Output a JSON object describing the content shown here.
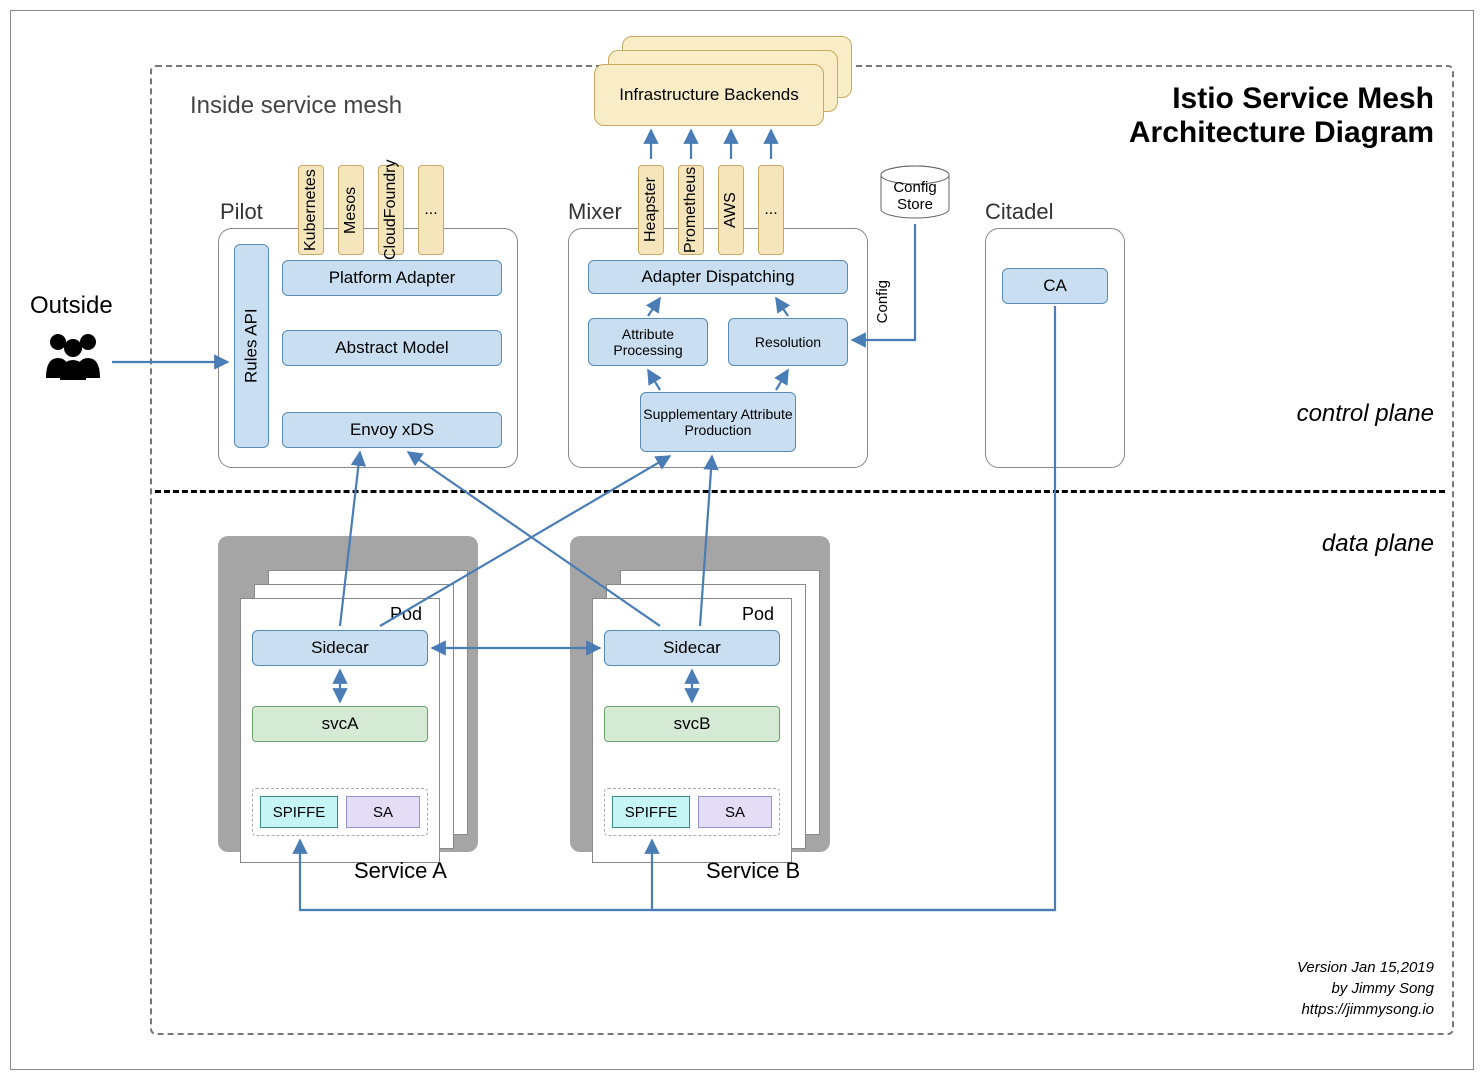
{
  "title": {
    "line1": "Istio Service Mesh",
    "line2": "Architecture Diagram"
  },
  "mesh_label": "Inside service mesh",
  "outside_label": "Outside",
  "planes": {
    "control": "control plane",
    "data": "data plane"
  },
  "pilot": {
    "label": "Pilot",
    "rules_api": "Rules API",
    "platform_adapter": "Platform Adapter",
    "abstract_model": "Abstract Model",
    "envoy_xds": "Envoy xDS",
    "platforms": [
      "Kubernetes",
      "Mesos",
      "CloudFoundry",
      "..."
    ]
  },
  "mixer": {
    "label": "Mixer",
    "adapter_dispatching": "Adapter Dispatching",
    "attribute_processing": "Attribute Processing",
    "resolution": "Resolution",
    "supplementary": "Supplementary Attribute Production",
    "adapters": [
      "Heapster",
      "Prometheus",
      "AWS",
      "..."
    ]
  },
  "infra_backends": "Infrastructure Backends",
  "config_store": {
    "label": "Config Store",
    "edge": "Config"
  },
  "citadel": {
    "label": "Citadel",
    "ca": "CA"
  },
  "services": {
    "a": {
      "pod": "Pod",
      "sidecar": "Sidecar",
      "svc": "svcA",
      "spiffe": "SPIFFE",
      "sa": "SA",
      "label": "Service A"
    },
    "b": {
      "pod": "Pod",
      "sidecar": "Sidecar",
      "svc": "svcB",
      "spiffe": "SPIFFE",
      "sa": "SA",
      "label": "Service B"
    }
  },
  "footer": {
    "version": "Version Jan 15,2019",
    "author": "by Jimmy Song",
    "url": "https://jimmysong.io"
  }
}
